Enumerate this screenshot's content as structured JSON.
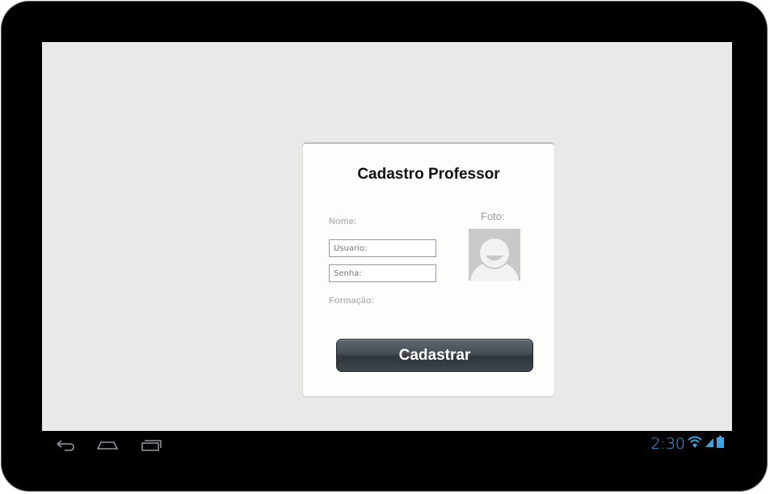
{
  "form": {
    "title": "Cadastro Professor",
    "nome_label": "Nome:",
    "usuario_placeholder": "Usuario:",
    "senha_placeholder": "Senha:",
    "formacao_label": "Formação:",
    "foto_label": "Foto:",
    "submit_label": "Cadastrar"
  },
  "status_bar": {
    "time": "2:30",
    "accent_color": "#3aa7e0",
    "icons": [
      "wifi-icon",
      "signal-icon",
      "battery-icon"
    ]
  },
  "nav_bar": {
    "icons": [
      "back-icon",
      "home-icon",
      "recent-apps-icon"
    ]
  }
}
